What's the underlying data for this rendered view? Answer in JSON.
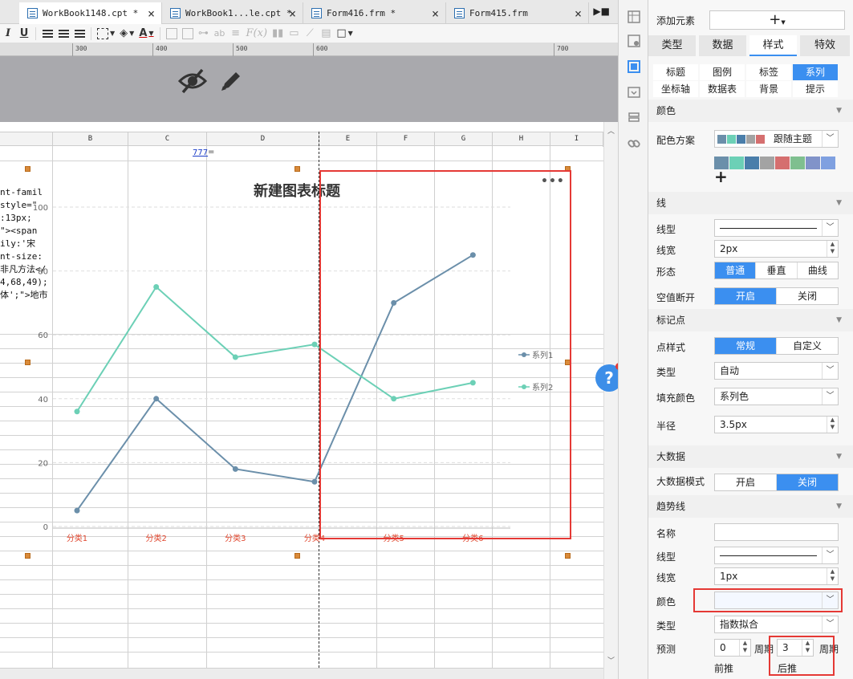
{
  "tabs": [
    {
      "label": "WorkBook1148.cpt *",
      "active": true
    },
    {
      "label": "WorkBook1...le.cpt *",
      "active": false
    },
    {
      "label": "Form416.frm *",
      "active": false
    },
    {
      "label": "Form415.frm",
      "active": false
    }
  ],
  "ruler": [
    "300",
    "400",
    "500",
    "600",
    "700"
  ],
  "columns": [
    "B",
    "C",
    "D",
    "E",
    "F",
    "G",
    "H",
    "I"
  ],
  "cell_ref": "777",
  "cell_ref_sign": "=",
  "code_lines": [
    "nt-famil",
    "style=\"",
    ":13px;",
    "\"><span",
    "ily:'宋",
    "nt-size:",
    "非凡方法</",
    "4,68,49);",
    "体';\">地市"
  ],
  "chart_data": {
    "type": "line",
    "title": "新建图表标题",
    "categories": [
      "分类1",
      "分类2",
      "分类3",
      "分类4",
      "分类5",
      "分类6"
    ],
    "series": [
      {
        "name": "系列1",
        "color": "#6b8faa",
        "values": [
          5,
          40,
          18,
          14,
          70,
          85
        ]
      },
      {
        "name": "系列2",
        "color": "#6cd0b6",
        "values": [
          36,
          75,
          53,
          57,
          40,
          45
        ]
      }
    ],
    "ylim": [
      0,
      100
    ],
    "yticks": [
      "0",
      "20",
      "40",
      "60",
      "80",
      "100"
    ],
    "legend": "right",
    "category_label_color": "#e0462e"
  },
  "panel": {
    "add_element_label": "添加元素",
    "add_element_icon": "plus-icon",
    "main_tabs": [
      "类型",
      "数据",
      "样式",
      "特效"
    ],
    "main_tab_active": "样式",
    "sub_tabs": [
      "标题",
      "图例",
      "标签",
      "系列",
      "坐标轴",
      "数据表",
      "背景",
      "提示"
    ],
    "sub_tab_active": "系列",
    "color_section": "颜色",
    "color_scheme_label": "配色方案",
    "color_scheme_value": "跟随主题",
    "swatch_colors": [
      "#6b8faa",
      "#6cd0b6",
      "#4a7eaa",
      "#a3a3a3",
      "#d56f6f",
      "#7fbf8f",
      "#8193c9",
      "#7fa0e0"
    ],
    "line_section": "线",
    "line_type_label": "线型",
    "line_width_label": "线宽",
    "line_width_value": "2px",
    "shape_label": "形态",
    "shape_options": [
      "普通",
      "垂直",
      "曲线"
    ],
    "shape_selected": "普通",
    "null_break_label": "空值断开",
    "null_break_options": [
      "开启",
      "关闭"
    ],
    "null_break_selected": "开启",
    "marker_section": "标记点",
    "point_style_label": "点样式",
    "point_style_options": [
      "常规",
      "自定义"
    ],
    "point_style_selected": "常规",
    "type_label": "类型",
    "type_value": "自动",
    "fill_color_label": "填充颜色",
    "fill_color_value": "系列色",
    "radius_label": "半径",
    "radius_value": "3.5px",
    "bigdata_section": "大数据",
    "bigdata_mode_label": "大数据模式",
    "bigdata_options": [
      "开启",
      "关闭"
    ],
    "bigdata_selected": "关闭",
    "trend_section": "趋势线",
    "trend_name_label": "名称",
    "trend_name_value": "",
    "trend_line_type_label": "线型",
    "trend_line_width_label": "线宽",
    "trend_line_width_value": "1px",
    "trend_color_label": "颜色",
    "trend_type_label": "类型",
    "trend_type_value": "指数拟合",
    "forecast_label": "预测",
    "forecast_forward_value": "0",
    "forecast_forward_unit": "周期",
    "forecast_forward_caption": "前推",
    "forecast_back_value": "3",
    "forecast_back_unit": "周期",
    "forecast_back_caption": "后推"
  }
}
